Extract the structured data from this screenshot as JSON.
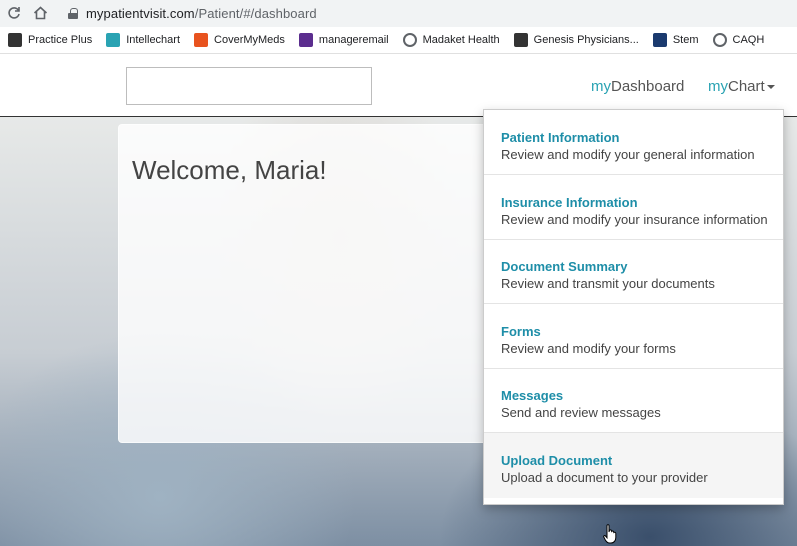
{
  "browser": {
    "url_host": "mypatientvisit.com",
    "url_path": "/Patient/#/dashboard",
    "bookmarks": [
      {
        "label": "Practice Plus",
        "icon": "practice-plus-icon",
        "color": "#333333"
      },
      {
        "label": "Intellechart",
        "icon": "intellechart-icon",
        "color": "#2aa3b3"
      },
      {
        "label": "CoverMyMeds",
        "icon": "covermymeds-icon",
        "color": "#e8531f"
      },
      {
        "label": "manageremail",
        "icon": "email-icon",
        "color": "#5b2d8e"
      },
      {
        "label": "Madaket Health",
        "icon": "globe-icon",
        "color": "#5f6368"
      },
      {
        "label": "Genesis Physicians...",
        "icon": "genesis-icon",
        "color": "#333333"
      },
      {
        "label": "Stem",
        "icon": "stem-icon",
        "color": "#1a3a6e"
      },
      {
        "label": "CAQH",
        "icon": "globe-icon",
        "color": "#5f6368"
      }
    ]
  },
  "nav": {
    "dashboard_prefix": "my",
    "dashboard_label": "Dashboard",
    "chart_prefix": "my",
    "chart_label": "Chart"
  },
  "welcome": {
    "text": "Welcome, Maria!"
  },
  "dropdown": {
    "items": [
      {
        "title": "Patient Information",
        "subtitle": "Review and modify your general information"
      },
      {
        "title": "Insurance Information",
        "subtitle": "Review and modify your insurance information"
      },
      {
        "title": "Document Summary",
        "subtitle": "Review and transmit your documents"
      },
      {
        "title": "Forms",
        "subtitle": "Review and modify your forms"
      },
      {
        "title": "Messages",
        "subtitle": "Send and review messages"
      },
      {
        "title": "Upload Document",
        "subtitle": "Upload a document to your provider"
      }
    ]
  },
  "colors": {
    "accent": "#2aa3b3",
    "link": "#1e8ea8"
  }
}
